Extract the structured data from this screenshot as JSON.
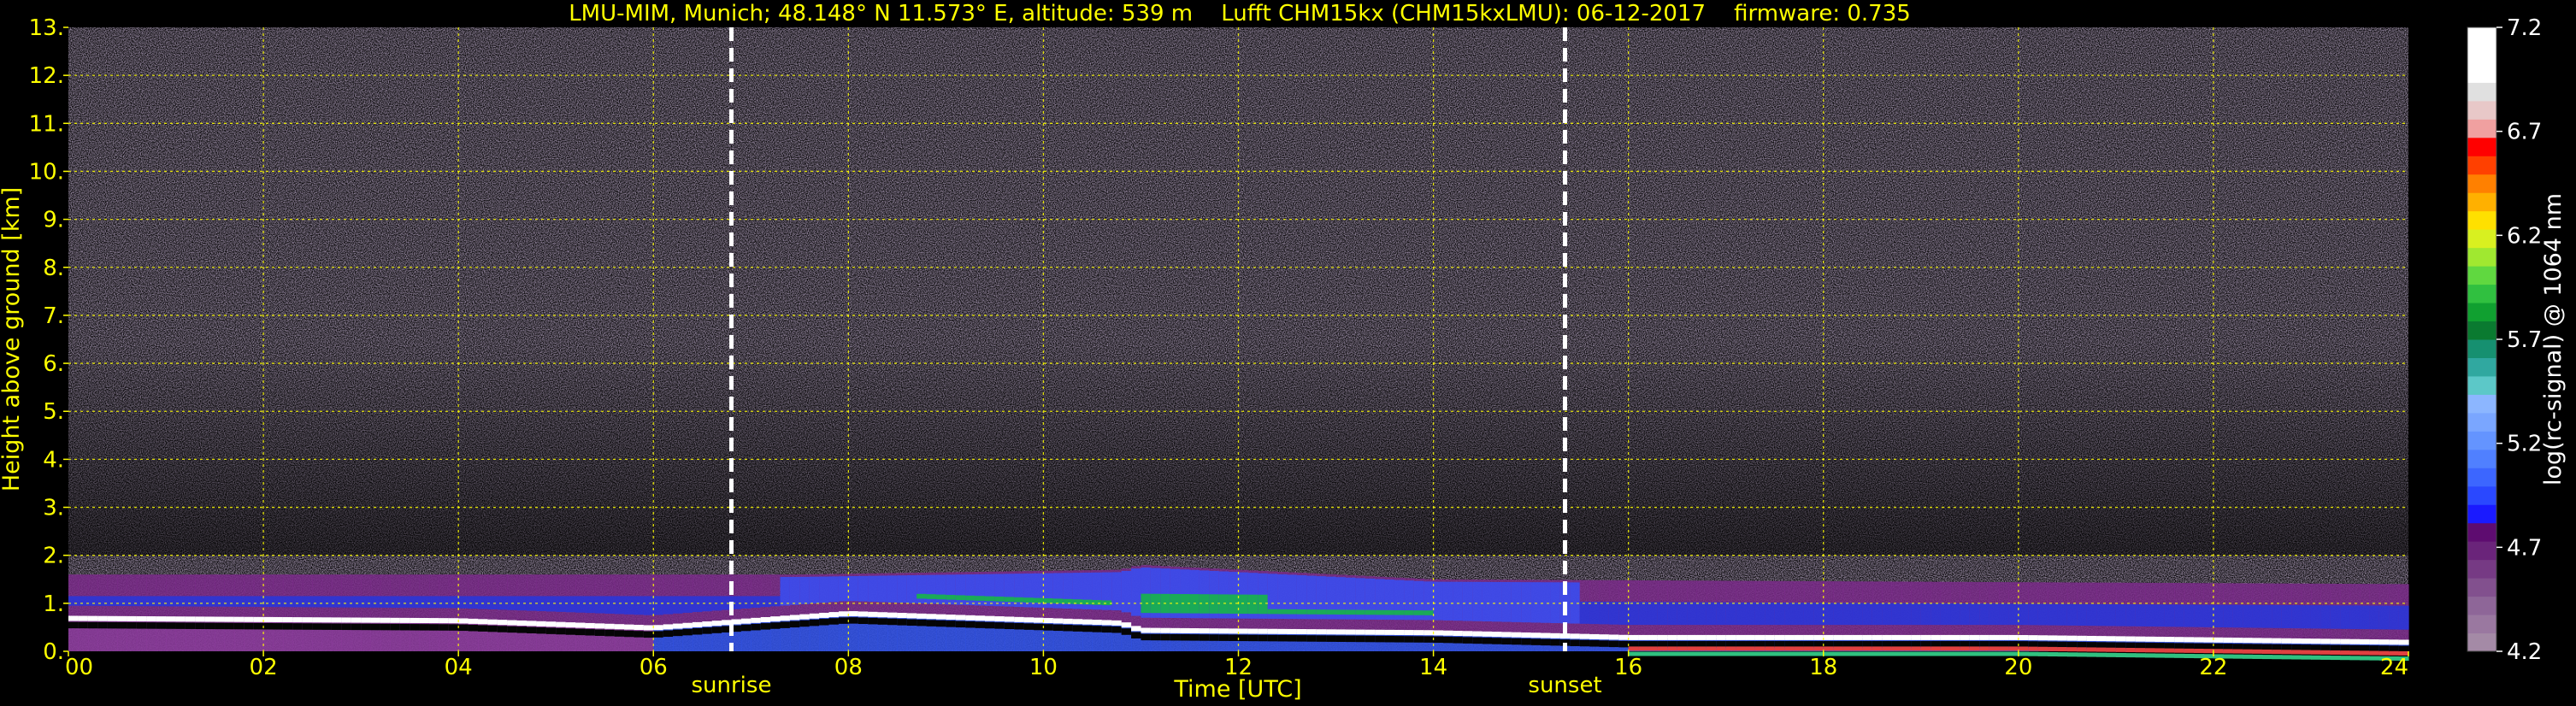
{
  "chart_data": {
    "type": "heatmap",
    "title": "LMU-MIM, Munich; 48.148° N 11.573° E, altitude: 539 m    Lufft CHM15kx (CHM15kxLMU): 06-12-2017    firmware: 0.735",
    "xlabel": "Time [UTC]",
    "ylabel": "Height above ground [km]",
    "xlim": [
      0,
      24
    ],
    "ylim": [
      0,
      13
    ],
    "x_ticks": [
      "00",
      "02",
      "04",
      "06",
      "08",
      "10",
      "12",
      "14",
      "16",
      "18",
      "20",
      "22",
      "24"
    ],
    "y_ticks": [
      "0.",
      "1.",
      "2.",
      "3.",
      "4.",
      "5.",
      "6.",
      "7.",
      "8.",
      "9.",
      "10.",
      "11.",
      "12.",
      "13."
    ],
    "grid": true,
    "annotations": [
      {
        "label": "sunrise",
        "x": 6.8
      },
      {
        "label": "sunset",
        "x": 15.35
      }
    ],
    "colorbar": {
      "label": "log(rc-signal) @ 1064 nm",
      "range": [
        4.2,
        7.2
      ],
      "ticks": [
        "7.2",
        "6.7",
        "6.2",
        "5.7",
        "5.2",
        "4.7",
        "4.2"
      ]
    },
    "layers": [
      {
        "name": "cloud base (black/white band)",
        "time": [
          0,
          4,
          6,
          8,
          10.8,
          11,
          14,
          16,
          20,
          24
        ],
        "height_km": [
          0.7,
          0.65,
          0.5,
          0.8,
          0.6,
          0.45,
          0.4,
          0.3,
          0.3,
          0.2
        ]
      },
      {
        "name": "aerosol layer top",
        "time": [
          0,
          7.5,
          10.8,
          11,
          14,
          24
        ],
        "height_km": [
          1.6,
          1.6,
          1.7,
          1.8,
          1.5,
          1.4
        ]
      }
    ],
    "colors": {
      "background": "#000000",
      "grid": "#ffff00",
      "text": "#ffff00",
      "noise": "#8a6f9a"
    }
  }
}
